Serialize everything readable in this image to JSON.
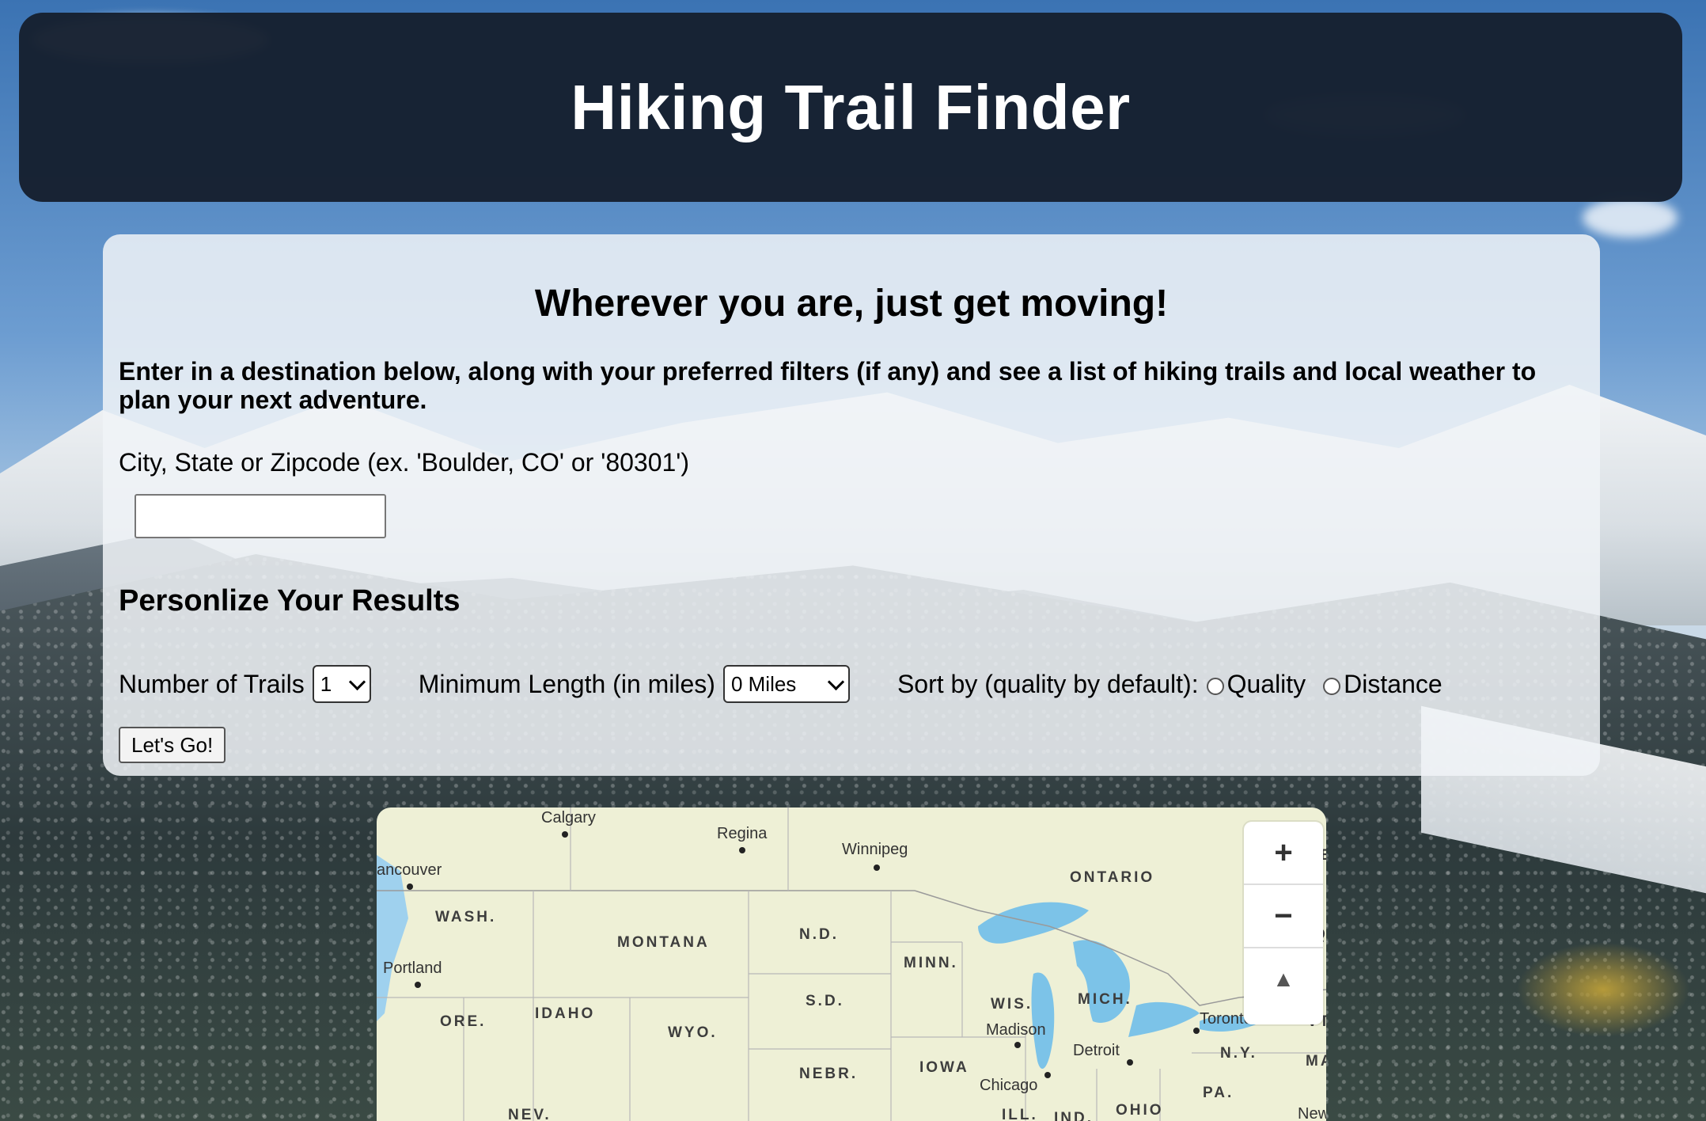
{
  "header": {
    "title": "Hiking Trail Finder"
  },
  "form": {
    "heading": "Wherever you are, just get moving!",
    "intro": "Enter in a destination below, along with your preferred filters (if any) and see a list of hiking trails and local weather to plan your next adventure.",
    "location_label": "City, State or Zipcode (ex. 'Boulder, CO' or '80301')",
    "location_value": "",
    "personalize_heading": "Personlize Your Results",
    "num_trails_label": "Number of Trails",
    "num_trails_value": "1",
    "min_length_label": "Minimum Length (in miles)",
    "min_length_value": "0 Miles",
    "sort_label": "Sort by (quality by default):",
    "sort_quality": "Quality",
    "sort_distance": "Distance",
    "submit_label": "Let's Go!"
  },
  "map": {
    "cities": [
      "Calgary",
      "Regina",
      "Winnipeg",
      "ancouver",
      "Portland",
      "Madison",
      "Detroit",
      "Chicago",
      "Toronto",
      "New"
    ],
    "regions": [
      "ONTARIO",
      "WASH.",
      "MONTANA",
      "N.D.",
      "MINN.",
      "S.D.",
      "WIS.",
      "MICH.",
      "ORE.",
      "IDAHO",
      "WYO.",
      "IOWA",
      "NEBR.",
      "N.Y.",
      "PA.",
      "OHIO",
      "NEV.",
      "ILL.",
      "IND.",
      "VT",
      "MA",
      "UE",
      "Q"
    ],
    "zoom_in": "+",
    "zoom_out": "−",
    "compass": "▲"
  }
}
